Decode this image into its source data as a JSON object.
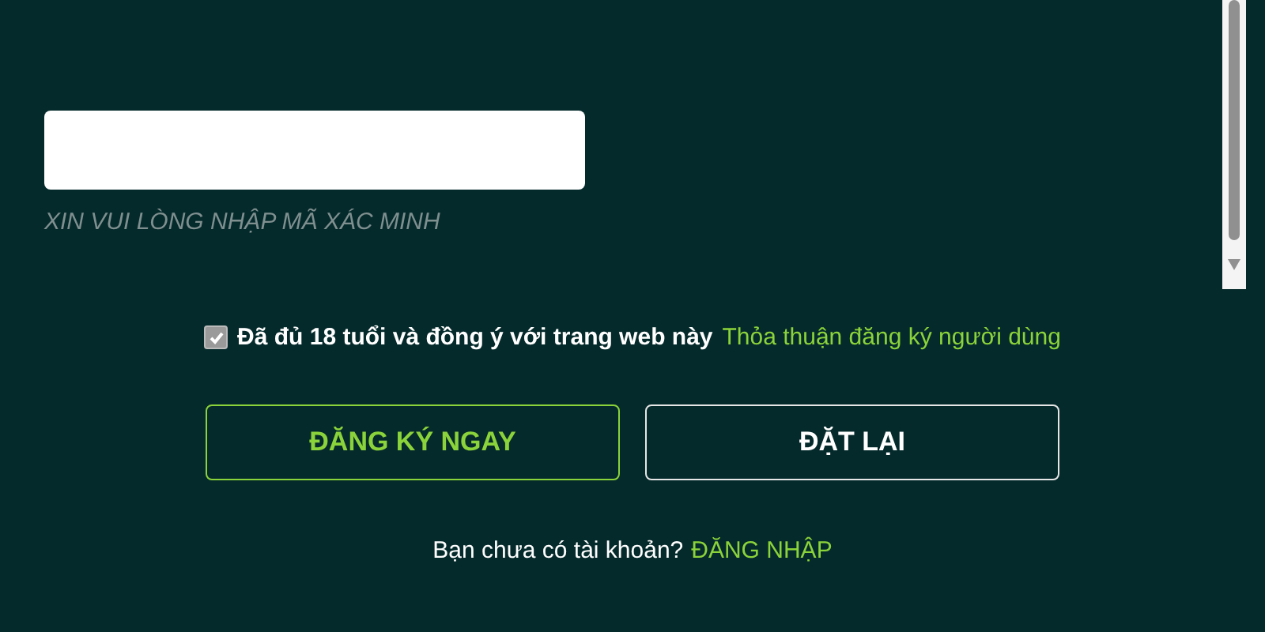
{
  "verification": {
    "hint": "XIN VUI LÒNG NHẬP MÃ XÁC MINH"
  },
  "agreement": {
    "checked": true,
    "text": "Đã đủ 18 tuổi và đồng ý với trang web này",
    "link": "Thỏa thuận đăng ký người dùng"
  },
  "buttons": [
    {
      "label": "ĐĂNG KÝ NGAY",
      "kind": "primary"
    },
    {
      "label": "ĐẶT LẠI",
      "kind": "secondary"
    }
  ],
  "footer": {
    "text": "Bạn chưa có tài khoản?",
    "link": "ĐĂNG NHẬP"
  }
}
